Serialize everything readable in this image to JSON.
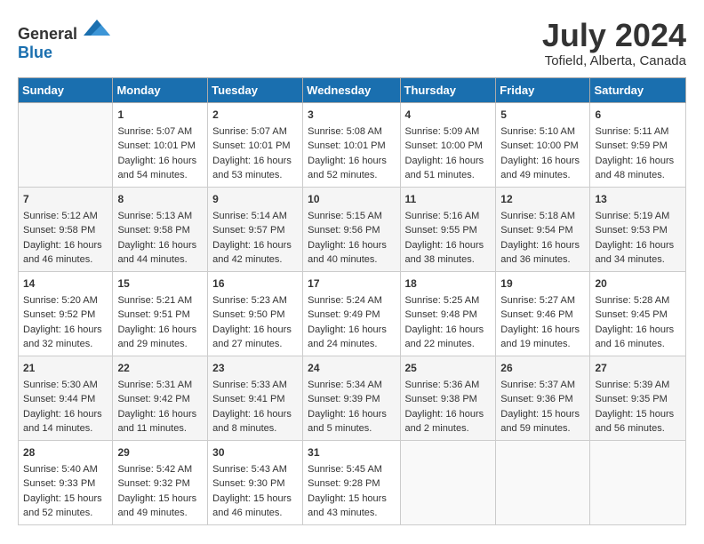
{
  "header": {
    "logo_general": "General",
    "logo_blue": "Blue",
    "month": "July 2024",
    "location": "Tofield, Alberta, Canada"
  },
  "calendar": {
    "days_of_week": [
      "Sunday",
      "Monday",
      "Tuesday",
      "Wednesday",
      "Thursday",
      "Friday",
      "Saturday"
    ],
    "weeks": [
      [
        {
          "day": "",
          "content": ""
        },
        {
          "day": "1",
          "content": "Sunrise: 5:07 AM\nSunset: 10:01 PM\nDaylight: 16 hours and 54 minutes."
        },
        {
          "day": "2",
          "content": "Sunrise: 5:07 AM\nSunset: 10:01 PM\nDaylight: 16 hours and 53 minutes."
        },
        {
          "day": "3",
          "content": "Sunrise: 5:08 AM\nSunset: 10:01 PM\nDaylight: 16 hours and 52 minutes."
        },
        {
          "day": "4",
          "content": "Sunrise: 5:09 AM\nSunset: 10:00 PM\nDaylight: 16 hours and 51 minutes."
        },
        {
          "day": "5",
          "content": "Sunrise: 5:10 AM\nSunset: 10:00 PM\nDaylight: 16 hours and 49 minutes."
        },
        {
          "day": "6",
          "content": "Sunrise: 5:11 AM\nSunset: 9:59 PM\nDaylight: 16 hours and 48 minutes."
        }
      ],
      [
        {
          "day": "7",
          "content": "Sunrise: 5:12 AM\nSunset: 9:58 PM\nDaylight: 16 hours and 46 minutes."
        },
        {
          "day": "8",
          "content": "Sunrise: 5:13 AM\nSunset: 9:58 PM\nDaylight: 16 hours and 44 minutes."
        },
        {
          "day": "9",
          "content": "Sunrise: 5:14 AM\nSunset: 9:57 PM\nDaylight: 16 hours and 42 minutes."
        },
        {
          "day": "10",
          "content": "Sunrise: 5:15 AM\nSunset: 9:56 PM\nDaylight: 16 hours and 40 minutes."
        },
        {
          "day": "11",
          "content": "Sunrise: 5:16 AM\nSunset: 9:55 PM\nDaylight: 16 hours and 38 minutes."
        },
        {
          "day": "12",
          "content": "Sunrise: 5:18 AM\nSunset: 9:54 PM\nDaylight: 16 hours and 36 minutes."
        },
        {
          "day": "13",
          "content": "Sunrise: 5:19 AM\nSunset: 9:53 PM\nDaylight: 16 hours and 34 minutes."
        }
      ],
      [
        {
          "day": "14",
          "content": "Sunrise: 5:20 AM\nSunset: 9:52 PM\nDaylight: 16 hours and 32 minutes."
        },
        {
          "day": "15",
          "content": "Sunrise: 5:21 AM\nSunset: 9:51 PM\nDaylight: 16 hours and 29 minutes."
        },
        {
          "day": "16",
          "content": "Sunrise: 5:23 AM\nSunset: 9:50 PM\nDaylight: 16 hours and 27 minutes."
        },
        {
          "day": "17",
          "content": "Sunrise: 5:24 AM\nSunset: 9:49 PM\nDaylight: 16 hours and 24 minutes."
        },
        {
          "day": "18",
          "content": "Sunrise: 5:25 AM\nSunset: 9:48 PM\nDaylight: 16 hours and 22 minutes."
        },
        {
          "day": "19",
          "content": "Sunrise: 5:27 AM\nSunset: 9:46 PM\nDaylight: 16 hours and 19 minutes."
        },
        {
          "day": "20",
          "content": "Sunrise: 5:28 AM\nSunset: 9:45 PM\nDaylight: 16 hours and 16 minutes."
        }
      ],
      [
        {
          "day": "21",
          "content": "Sunrise: 5:30 AM\nSunset: 9:44 PM\nDaylight: 16 hours and 14 minutes."
        },
        {
          "day": "22",
          "content": "Sunrise: 5:31 AM\nSunset: 9:42 PM\nDaylight: 16 hours and 11 minutes."
        },
        {
          "day": "23",
          "content": "Sunrise: 5:33 AM\nSunset: 9:41 PM\nDaylight: 16 hours and 8 minutes."
        },
        {
          "day": "24",
          "content": "Sunrise: 5:34 AM\nSunset: 9:39 PM\nDaylight: 16 hours and 5 minutes."
        },
        {
          "day": "25",
          "content": "Sunrise: 5:36 AM\nSunset: 9:38 PM\nDaylight: 16 hours and 2 minutes."
        },
        {
          "day": "26",
          "content": "Sunrise: 5:37 AM\nSunset: 9:36 PM\nDaylight: 15 hours and 59 minutes."
        },
        {
          "day": "27",
          "content": "Sunrise: 5:39 AM\nSunset: 9:35 PM\nDaylight: 15 hours and 56 minutes."
        }
      ],
      [
        {
          "day": "28",
          "content": "Sunrise: 5:40 AM\nSunset: 9:33 PM\nDaylight: 15 hours and 52 minutes."
        },
        {
          "day": "29",
          "content": "Sunrise: 5:42 AM\nSunset: 9:32 PM\nDaylight: 15 hours and 49 minutes."
        },
        {
          "day": "30",
          "content": "Sunrise: 5:43 AM\nSunset: 9:30 PM\nDaylight: 15 hours and 46 minutes."
        },
        {
          "day": "31",
          "content": "Sunrise: 5:45 AM\nSunset: 9:28 PM\nDaylight: 15 hours and 43 minutes."
        },
        {
          "day": "",
          "content": ""
        },
        {
          "day": "",
          "content": ""
        },
        {
          "day": "",
          "content": ""
        }
      ]
    ]
  }
}
